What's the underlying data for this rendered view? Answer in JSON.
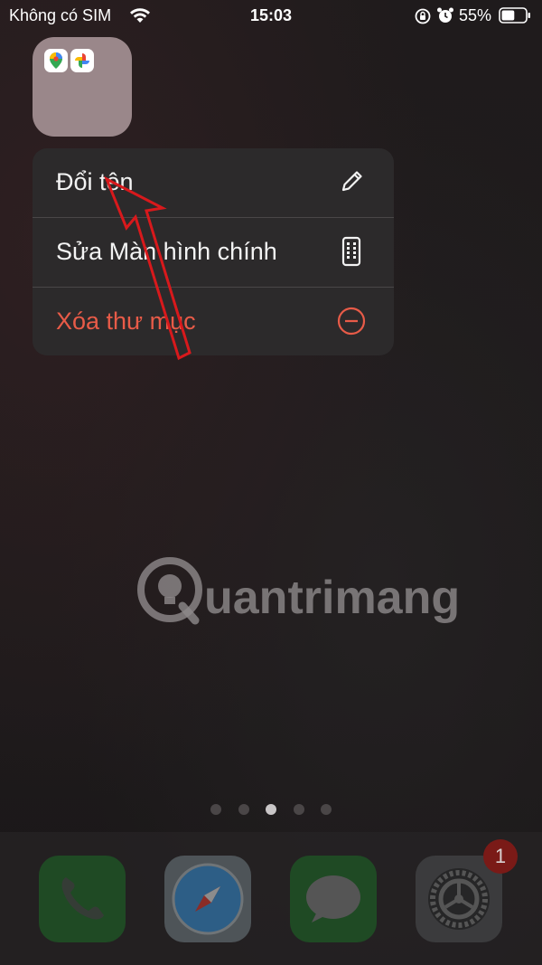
{
  "status_bar": {
    "carrier": "Không có SIM",
    "time": "15:03",
    "battery_percent": "55%",
    "battery_level": 0.55,
    "icons": [
      "wifi-icon",
      "rotation-lock-icon",
      "alarm-icon",
      "battery-icon"
    ]
  },
  "folder": {
    "apps": [
      "google-maps-icon",
      "google-photos-icon"
    ]
  },
  "context_menu": {
    "items": [
      {
        "label": "Đổi tên",
        "icon": "pencil-icon",
        "color": "#f3f3f3"
      },
      {
        "label": "Sửa Màn hình chính",
        "icon": "phone-apps-icon",
        "color": "#f3f3f3"
      },
      {
        "label": "Xóa thư mục",
        "icon": "minus-circle-icon",
        "color": "#e85b48"
      }
    ]
  },
  "watermark": {
    "text": "uantrimang"
  },
  "page_dots": {
    "count": 5,
    "active_index": 2
  },
  "dock": {
    "apps": [
      {
        "name": "phone-app",
        "color": "#1f5c28"
      },
      {
        "name": "safari-app",
        "color": "#3d4a5a"
      },
      {
        "name": "messages-app",
        "color": "#1f5c28"
      },
      {
        "name": "settings-app",
        "color": "#3a3a3c"
      }
    ],
    "settings_badge": "1"
  },
  "colors": {
    "menu_bg": "#2c2a2b",
    "destructive": "#e85b48",
    "annotation_arrow": "#d8191c"
  }
}
